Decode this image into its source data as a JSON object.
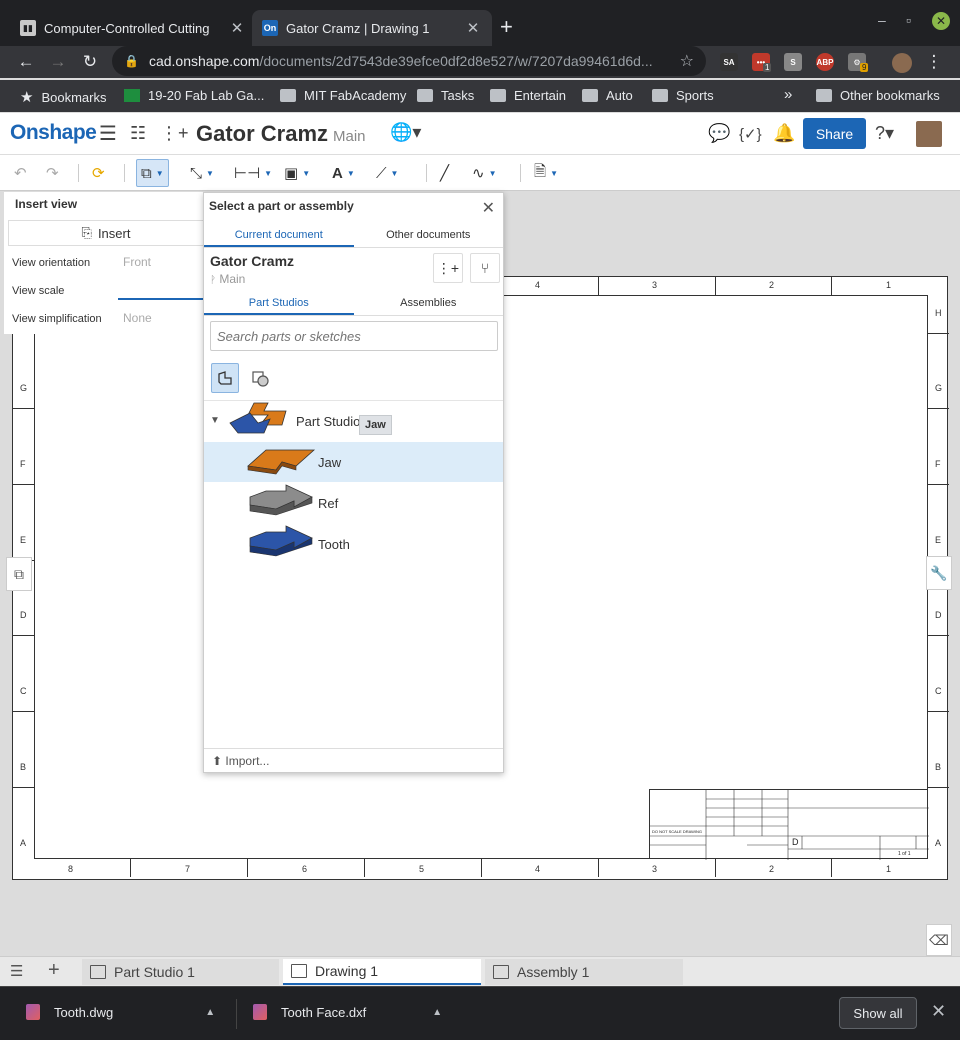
{
  "browser": {
    "tabs": [
      {
        "title": "Computer-Controlled Cutting",
        "favicon": "fab-academy-icon"
      },
      {
        "title": "Gator Cramz | Drawing 1",
        "favicon": "onshape-icon",
        "favicon_text": "On"
      }
    ],
    "url_host": "cad.onshape.com",
    "url_path": "/documents/2d7543de39efce0df2d8e527/w/7207da99461d6d...",
    "extension_badges": {
      "ext_red": "1",
      "ext_orange": "9"
    },
    "extension_labels": {
      "sa": "SA",
      "s": "S",
      "abp": "ABP"
    },
    "bookmarks": [
      "Bookmarks",
      "19-20 Fab Lab Ga...",
      "MIT FabAcademy",
      "Tasks",
      "Entertain",
      "Auto",
      "Sports"
    ],
    "overflow": "»",
    "other_bookmarks": "Other bookmarks"
  },
  "app": {
    "logo": "Onshape",
    "doc_title": "Gator Cramz",
    "branch": "Main",
    "share": "Share",
    "accent": "#1c66b5"
  },
  "insert_panel": {
    "title": "Insert view",
    "insert_label": "Insert",
    "rows": [
      {
        "label": "View orientation",
        "value": "Front"
      },
      {
        "label": "View scale",
        "value": ""
      },
      {
        "label": "View simplification",
        "value": "None"
      }
    ]
  },
  "dialog": {
    "title": "Select a part or assembly",
    "tabs": [
      "Current document",
      "Other documents"
    ],
    "doc_name": "Gator Cramz",
    "doc_branch": "Main",
    "sub_tabs": [
      "Part Studios",
      "Assemblies"
    ],
    "search_placeholder": "Search parts or sketches",
    "tree": [
      {
        "label": "Part Studio 1",
        "color": "#d97a1a",
        "type": "studio"
      },
      {
        "label": "Jaw",
        "color": "#d97a1a",
        "type": "part"
      },
      {
        "label": "Ref",
        "color": "#8c8c8c",
        "type": "part"
      },
      {
        "label": "Tooth",
        "color": "#2c55a8",
        "type": "part"
      }
    ],
    "tooltip": "Jaw",
    "import": "Import..."
  },
  "sheet": {
    "columns": [
      "8",
      "7",
      "6",
      "5",
      "4",
      "3",
      "2",
      "1"
    ],
    "rows": [
      "H",
      "G",
      "F",
      "E",
      "D",
      "C",
      "B",
      "A"
    ],
    "title_block": {
      "size": "D",
      "sheet": "1 of 1",
      "note": "DO NOT SCALE DRAWING"
    }
  },
  "bottom_tabs": [
    "Part Studio 1",
    "Drawing 1",
    "Assembly 1"
  ],
  "downloads": {
    "files": [
      "Tooth.dwg",
      "Tooth Face.dxf"
    ],
    "show_all": "Show all"
  }
}
